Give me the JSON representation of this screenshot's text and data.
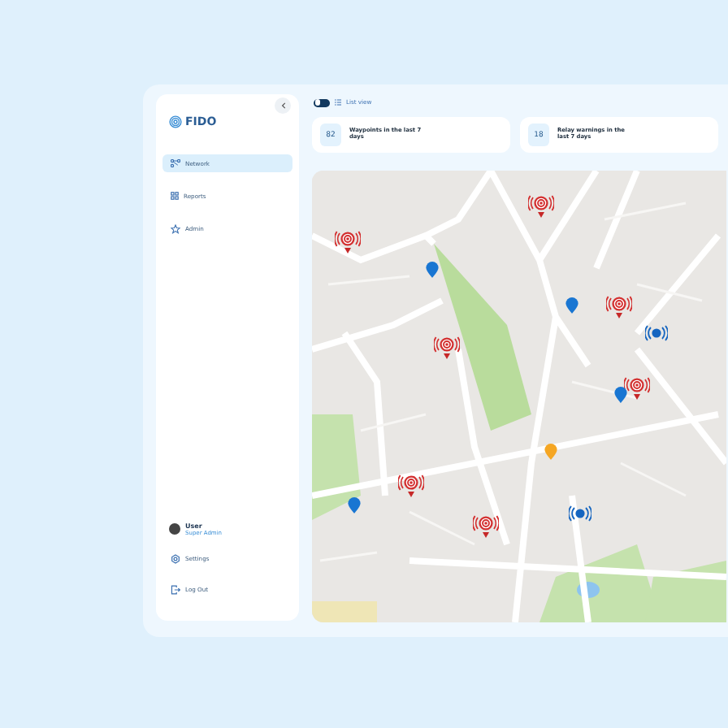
{
  "sidebar": {
    "logo": "FIDO",
    "items": [
      {
        "label": "Network",
        "kind": "network",
        "selected": true
      },
      {
        "label": "Reports",
        "kind": "reports",
        "selected": false
      },
      {
        "label": "Admin",
        "kind": "admin",
        "selected": false
      }
    ],
    "user": {
      "name": "User",
      "role": "Super Admin"
    },
    "footer_items": [
      {
        "label": "Settings",
        "kind": "settings"
      },
      {
        "label": "Log Out",
        "kind": "logout"
      }
    ]
  },
  "view_toggle": {
    "on": false,
    "label": "List view"
  },
  "stats": [
    {
      "value": "82",
      "label": "Waypoints in the last 7 days"
    },
    {
      "value": "18",
      "label": "Relay warnings in the last 7 days"
    }
  ]
}
